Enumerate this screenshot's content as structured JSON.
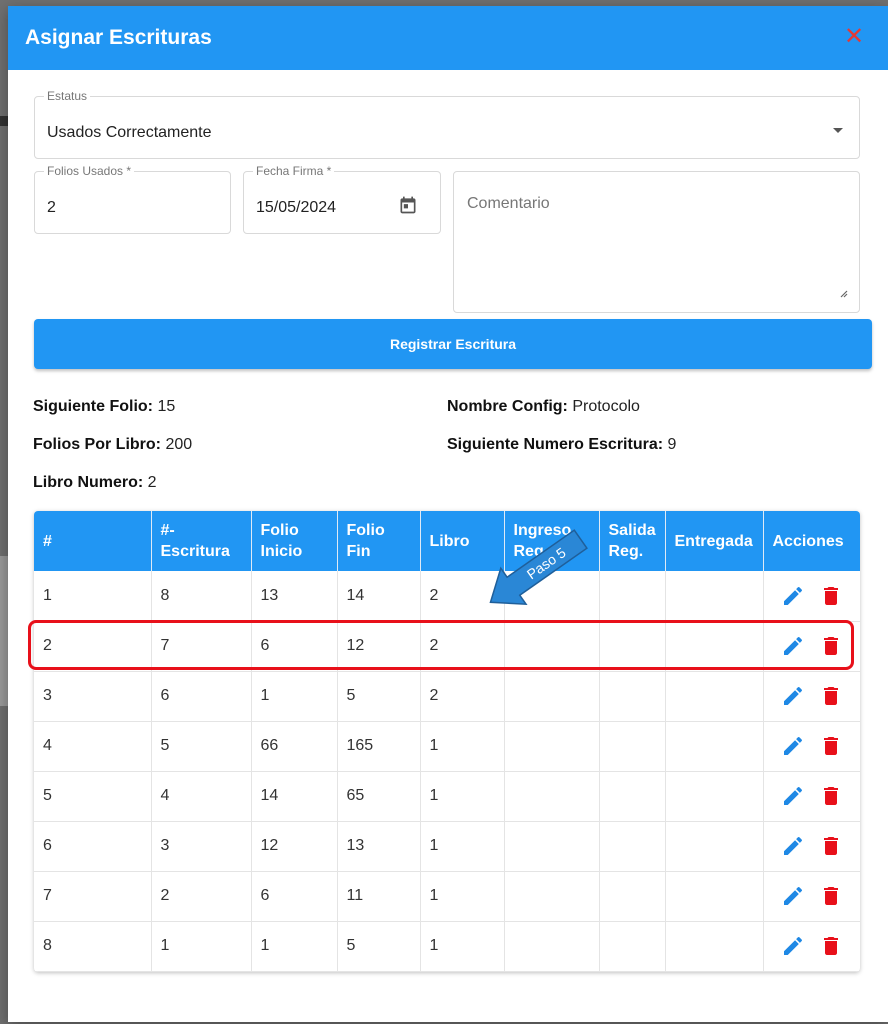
{
  "dialog": {
    "title": "Asignar Escrituras",
    "close_icon": "close-icon"
  },
  "form": {
    "estatus": {
      "label": "Estatus",
      "value": "Usados Correctamente"
    },
    "folios_usados": {
      "label": "Folios Usados *",
      "value": "2"
    },
    "fecha_firma": {
      "label": "Fecha Firma *",
      "value": "15/05/2024"
    },
    "comentario": {
      "placeholder": "Comentario"
    },
    "register_label": "Registrar Escritura"
  },
  "info": {
    "siguiente_folio": {
      "label": "Siguiente Folio:",
      "value": "15"
    },
    "nombre_config": {
      "label": "Nombre Config:",
      "value": "Protocolo"
    },
    "folios_por_libro": {
      "label": "Folios Por Libro:",
      "value": "200"
    },
    "siguiente_numero_escritura": {
      "label": "Siguiente Numero Escritura:",
      "value": "9"
    },
    "libro_numero": {
      "label": "Libro Numero:",
      "value": "2"
    }
  },
  "table": {
    "headers": [
      "#",
      "#-\nEscritura",
      "Folio\nInicio",
      "Folio\nFin",
      "Libro",
      "Ingreso\nReg.",
      "Salida\nReg.",
      "Entregada",
      "Acciones"
    ],
    "rows": [
      [
        "1",
        "8",
        "13",
        "14",
        "2",
        "",
        "",
        ""
      ],
      [
        "2",
        "7",
        "6",
        "12",
        "2",
        "",
        "",
        ""
      ],
      [
        "3",
        "6",
        "1",
        "5",
        "2",
        "",
        "",
        ""
      ],
      [
        "4",
        "5",
        "66",
        "165",
        "1",
        "",
        "",
        ""
      ],
      [
        "5",
        "4",
        "14",
        "65",
        "1",
        "",
        "",
        ""
      ],
      [
        "6",
        "3",
        "12",
        "13",
        "1",
        "",
        "",
        ""
      ],
      [
        "7",
        "2",
        "6",
        "11",
        "1",
        "",
        "",
        ""
      ],
      [
        "8",
        "1",
        "1",
        "5",
        "1",
        "",
        "",
        ""
      ]
    ],
    "highlighted_row": 2
  },
  "annotation": {
    "text": "Paso 5"
  },
  "colors": {
    "primary": "#2196f3",
    "delete": "#e8101a",
    "highlight": "#e8101a",
    "close": "#e53935"
  }
}
